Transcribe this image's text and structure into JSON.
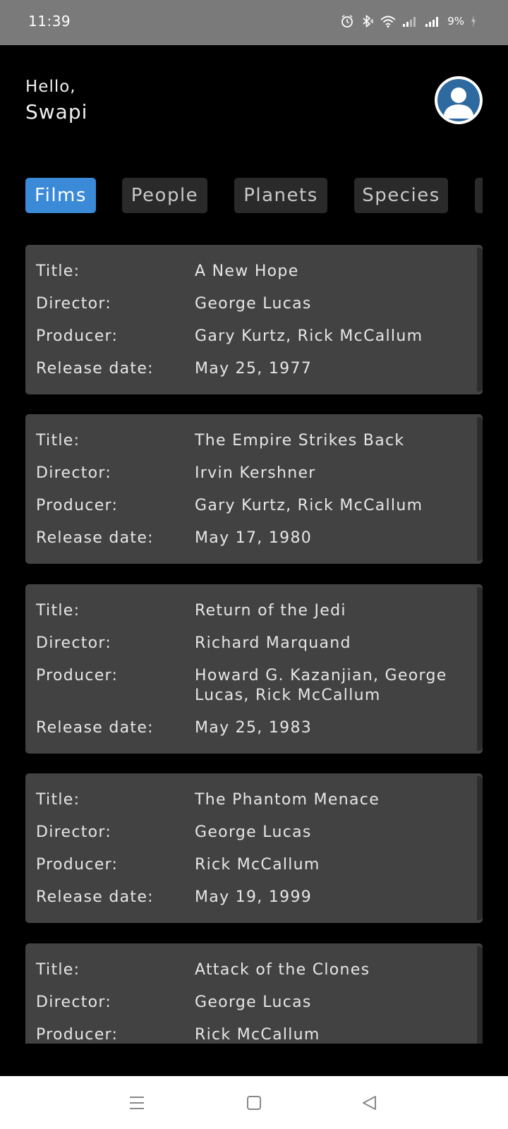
{
  "status_bar": {
    "time": "11:39",
    "battery": "9%"
  },
  "greeting": {
    "hello": "Hello,",
    "name": "Swapi"
  },
  "tabs": [
    {
      "label": "Films",
      "active": true
    },
    {
      "label": "People",
      "active": false
    },
    {
      "label": "Planets",
      "active": false
    },
    {
      "label": "Species",
      "active": false
    },
    {
      "label": "",
      "active": false
    }
  ],
  "labels": {
    "title": "Title:",
    "director": "Director:",
    "producer": "Producer:",
    "release_date": "Release date:"
  },
  "films": [
    {
      "title": "A New Hope",
      "director": "George Lucas",
      "producer": "Gary Kurtz, Rick McCallum",
      "release_date": "May 25, 1977"
    },
    {
      "title": "The Empire Strikes Back",
      "director": "Irvin Kershner",
      "producer": "Gary Kurtz, Rick McCallum",
      "release_date": "May 17, 1980"
    },
    {
      "title": "Return of the Jedi",
      "director": "Richard Marquand",
      "producer": "Howard G. Kazanjian, George Lucas, Rick McCallum",
      "release_date": "May 25, 1983"
    },
    {
      "title": "The Phantom Menace",
      "director": "George Lucas",
      "producer": "Rick McCallum",
      "release_date": "May 19, 1999"
    },
    {
      "title": "Attack of the Clones",
      "director": "George Lucas",
      "producer": "Rick McCallum",
      "release_date": ""
    }
  ],
  "colors": {
    "accent": "#3b8ad8",
    "card": "#424242",
    "tab": "#2a2a2a",
    "status_bar": "#7a7a7a"
  },
  "icons": [
    "alarm-icon",
    "bluetooth-icon",
    "wifi-icon",
    "signal-icon",
    "battery-icon",
    "avatar-icon",
    "menu-icon",
    "home-icon",
    "back-icon"
  ]
}
